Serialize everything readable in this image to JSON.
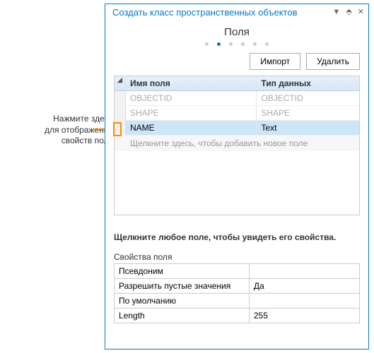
{
  "annotation": {
    "line1": "Нажмите здесь",
    "line2": "для отображения",
    "line3": "свойств поля"
  },
  "panel": {
    "title": "Создать класс пространственных объектов",
    "controls": {
      "dropdown": "▼",
      "pin": "⬘",
      "close": "✕"
    }
  },
  "wizard": {
    "stepTitle": "Поля",
    "activeIndex": 1,
    "totalSteps": 6
  },
  "buttons": {
    "import": "Импорт",
    "delete": "Удалить"
  },
  "fieldsTable": {
    "handleGlyph": "◢",
    "headers": {
      "name": "Имя поля",
      "type": "Тип данных"
    },
    "rows": [
      {
        "name": "OBJECTID",
        "type": "OBJECTID",
        "disabled": true,
        "selected": false
      },
      {
        "name": "SHAPE",
        "type": "SHAPE",
        "disabled": true,
        "selected": false
      },
      {
        "name": "NAME",
        "type": "Text",
        "disabled": false,
        "selected": true
      }
    ],
    "addHint": "Щелкните здесь, чтобы добавить новое поле"
  },
  "status": "Щелкните любое поле, чтобы увидеть его свойства.",
  "properties": {
    "title": "Свойства поля",
    "rows": [
      {
        "label": "Псевдоним",
        "value": ""
      },
      {
        "label": "Разрешить пустые значения",
        "value": "Да"
      },
      {
        "label": "По умолчанию",
        "value": ""
      },
      {
        "label": "Length",
        "value": "255"
      }
    ]
  }
}
